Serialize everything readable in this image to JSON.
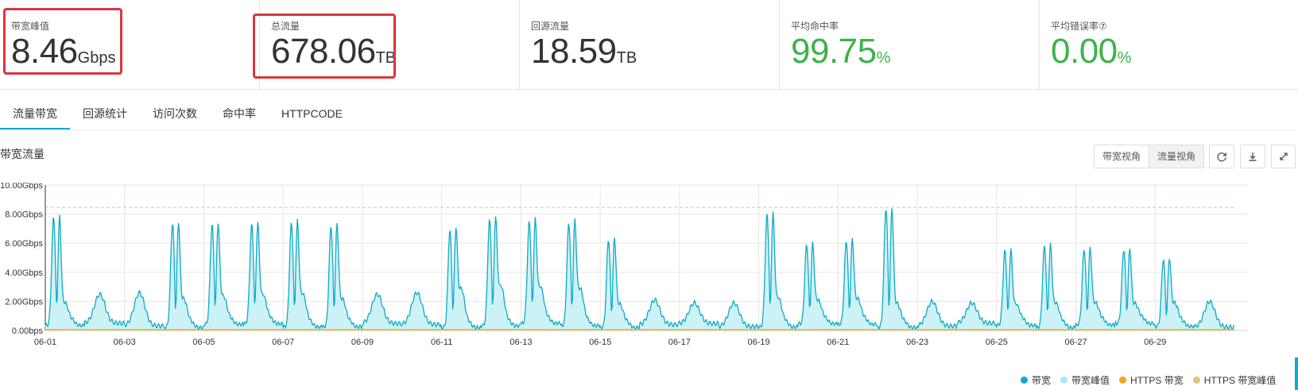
{
  "stats": [
    {
      "label": "带宽峰值",
      "value": "8.46",
      "unit": "Gbps",
      "color": "#333333",
      "highlighted": true
    },
    {
      "label": "总流量",
      "value": "678.06",
      "unit": "TB",
      "color": "#333333",
      "highlighted": true
    },
    {
      "label": "回源流量",
      "value": "18.59",
      "unit": "TB",
      "color": "#333333",
      "highlighted": false
    },
    {
      "label": "平均命中率",
      "value": "99.75",
      "unit": "%",
      "color": "#3cb34a",
      "highlighted": false
    },
    {
      "label": "平均错误率⑦",
      "value": "0.00",
      "unit": "%",
      "color": "#3cb34a",
      "highlighted": false
    }
  ],
  "tabs": [
    "流量带宽",
    "回源统计",
    "访问次数",
    "命中率",
    "HTTPCODE"
  ],
  "active_tab": 0,
  "section_title": "带宽流量",
  "view_buttons": {
    "bandwidth": "带宽视角",
    "traffic": "流量视角"
  },
  "icons": {
    "refresh": "refresh-icon",
    "download": "download-icon",
    "fullscreen": "expand-icon"
  },
  "colors": {
    "accent": "#11a9c8",
    "fill": "#c9f1f6",
    "peak": "#a8ecf2",
    "https": "#f5a623",
    "https_peak": "#e8c07d",
    "highlight": "#d9363e",
    "good": "#3cb34a"
  },
  "chart_data": {
    "type": "area",
    "title": "",
    "xlabel": "",
    "ylabel": "",
    "x_ticks": [
      "06-01",
      "06-03",
      "06-05",
      "06-07",
      "06-09",
      "06-11",
      "06-13",
      "06-15",
      "06-17",
      "06-19",
      "06-21",
      "06-23",
      "06-25",
      "06-27",
      "06-29"
    ],
    "y_ticks": [
      "0.00bps",
      "2.00Gbps",
      "4.00Gbps",
      "6.00Gbps",
      "8.00Gbps",
      "10.00Gbps"
    ],
    "ylim": [
      0,
      10
    ],
    "y_unit": "Gbps",
    "xlim": [
      0,
      30
    ],
    "grid": true,
    "legend_position": "bottom-right",
    "peak_value": 8.46,
    "series": [
      {
        "name": "带宽",
        "color": "#11a9c8",
        "daily_profile": [
          {
            "day": "06-01",
            "peak": 7.8,
            "shape": "double",
            "base": 2.1
          },
          {
            "day": "06-02",
            "peak": 2.5,
            "shape": "flat",
            "base": 2.2
          },
          {
            "day": "06-03",
            "peak": 2.6,
            "shape": "flat",
            "base": 2.3
          },
          {
            "day": "06-04",
            "peak": 7.4,
            "shape": "double",
            "base": 2.4
          },
          {
            "day": "06-05",
            "peak": 7.3,
            "shape": "double",
            "base": 2.6
          },
          {
            "day": "06-06",
            "peak": 7.3,
            "shape": "double",
            "base": 2.7
          },
          {
            "day": "06-07",
            "peak": 7.4,
            "shape": "double",
            "base": 2.8
          },
          {
            "day": "06-08",
            "peak": 7.2,
            "shape": "double",
            "base": 2.4
          },
          {
            "day": "06-09",
            "peak": 2.5,
            "shape": "flat",
            "base": 2.3
          },
          {
            "day": "06-10",
            "peak": 2.6,
            "shape": "flat",
            "base": 2.4
          },
          {
            "day": "06-11",
            "peak": 6.9,
            "shape": "double",
            "base": 3.2
          },
          {
            "day": "06-12",
            "peak": 7.6,
            "shape": "double",
            "base": 3.4
          },
          {
            "day": "06-13",
            "peak": 7.5,
            "shape": "double",
            "base": 3.3
          },
          {
            "day": "06-14",
            "peak": 7.4,
            "shape": "double",
            "base": 3.2
          },
          {
            "day": "06-15",
            "peak": 6.3,
            "shape": "double",
            "base": 2.0
          },
          {
            "day": "06-16",
            "peak": 2.1,
            "shape": "flat",
            "base": 1.9
          },
          {
            "day": "06-17",
            "peak": 1.9,
            "shape": "flat",
            "base": 1.8
          },
          {
            "day": "06-18",
            "peak": 1.9,
            "shape": "flat",
            "base": 1.8
          },
          {
            "day": "06-19",
            "peak": 8.0,
            "shape": "double",
            "base": 2.5
          },
          {
            "day": "06-20",
            "peak": 5.9,
            "shape": "double",
            "base": 2.3
          },
          {
            "day": "06-21",
            "peak": 6.2,
            "shape": "double",
            "base": 2.4
          },
          {
            "day": "06-22",
            "peak": 8.46,
            "shape": "double",
            "base": 2.0
          },
          {
            "day": "06-23",
            "peak": 2.0,
            "shape": "flat",
            "base": 1.8
          },
          {
            "day": "06-24",
            "peak": 1.9,
            "shape": "flat",
            "base": 1.7
          },
          {
            "day": "06-25",
            "peak": 5.5,
            "shape": "double",
            "base": 2.0
          },
          {
            "day": "06-26",
            "peak": 5.8,
            "shape": "double",
            "base": 2.1
          },
          {
            "day": "06-27",
            "peak": 5.6,
            "shape": "double",
            "base": 2.1
          },
          {
            "day": "06-28",
            "peak": 5.6,
            "shape": "double",
            "base": 2.0
          },
          {
            "day": "06-29",
            "peak": 4.9,
            "shape": "double",
            "base": 2.1
          },
          {
            "day": "06-30",
            "peak": 2.0,
            "shape": "flat",
            "base": 1.6
          }
        ]
      },
      {
        "name": "带宽峰值",
        "color": "#a8ecf2",
        "value": 8.46
      },
      {
        "name": "HTTPS 带宽",
        "color": "#f5a623",
        "value": 0.05
      },
      {
        "name": "HTTPS 带宽峰值",
        "color": "#e8c07d",
        "value": 0.1
      }
    ]
  }
}
